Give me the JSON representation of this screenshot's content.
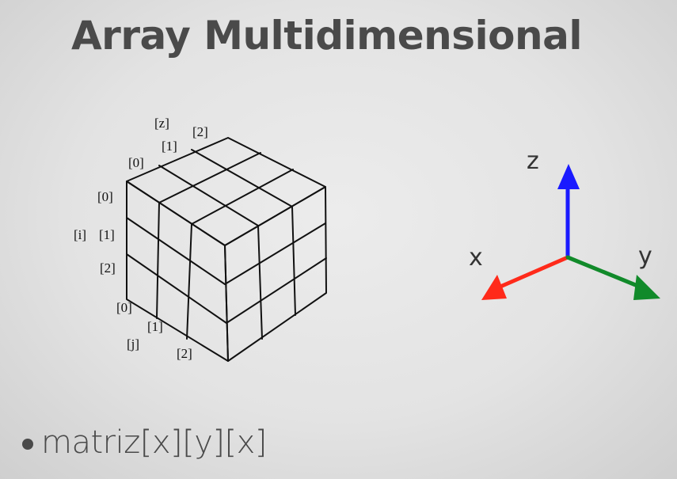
{
  "slide": {
    "title": "Array Multidimensional"
  },
  "cube": {
    "z_axis_label": "[z]",
    "z_indices": [
      "[0]",
      "[1]",
      "[2]"
    ],
    "i_axis_label": "[i]",
    "i_indices": [
      "[0]",
      "[1]",
      "[2]"
    ],
    "j_axis_label": "[j]",
    "j_indices": [
      "[0]",
      "[1]",
      "[2]"
    ]
  },
  "axes": {
    "z_label": "z",
    "x_label": "x",
    "y_label": "y",
    "colors": {
      "z": "#1a1aff",
      "x": "#ff2a1a",
      "y": "#118a2a"
    }
  },
  "bullet": {
    "text": "matriz[x][y][x]"
  }
}
